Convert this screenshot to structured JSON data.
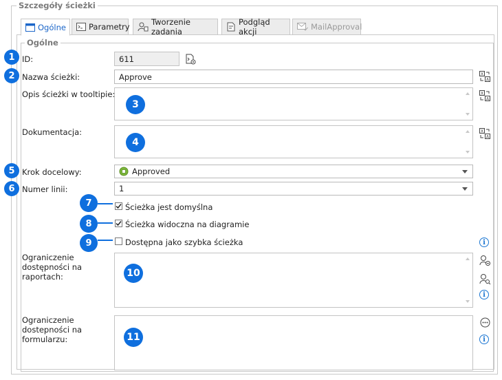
{
  "outer_legend": "Szczegóły ścieżki",
  "tabs": [
    {
      "label": "Ogólne",
      "icon": "window-icon",
      "active": true
    },
    {
      "label": "Parametry",
      "icon": "console-icon"
    },
    {
      "label": "Tworzenie zadania",
      "icon": "user-task-icon"
    },
    {
      "label": "Podgląd akcji",
      "icon": "document-preview-icon"
    },
    {
      "label": "MailApproval",
      "icon": "mail-check-icon",
      "disabled": true
    }
  ],
  "inner_legend": "Ogólne",
  "fields": {
    "id_label": "ID:",
    "id_value": "611",
    "name_label": "Nazwa ścieżki:",
    "name_value": "Approve",
    "tooltip_label": "Opis ścieżki w tooltipie:",
    "documentation_label": "Dokumentacja:",
    "target_step_label": "Krok docelowy:",
    "target_step_value": "Approved",
    "line_number_label": "Numer linii:",
    "line_number_value": "1",
    "cb_default_label": "Ścieżka jest domyślna",
    "cb_default_checked": true,
    "cb_visible_label": "Ścieżka widoczna na diagramie",
    "cb_visible_checked": true,
    "cb_quick_label": "Dostępna jako szybka ścieżka",
    "cb_quick_checked": false,
    "report_restriction_label": "Ograniczenie dostępności na raportach:",
    "form_restriction_label": "Ograniczenie dostepności na formularzu:"
  },
  "badges": [
    "1",
    "2",
    "3",
    "4",
    "5",
    "6",
    "7",
    "8",
    "9",
    "10",
    "11"
  ],
  "colors": {
    "badge": "#0f6fde",
    "info": "#1b76d2",
    "approved_step": "#7db83a"
  }
}
